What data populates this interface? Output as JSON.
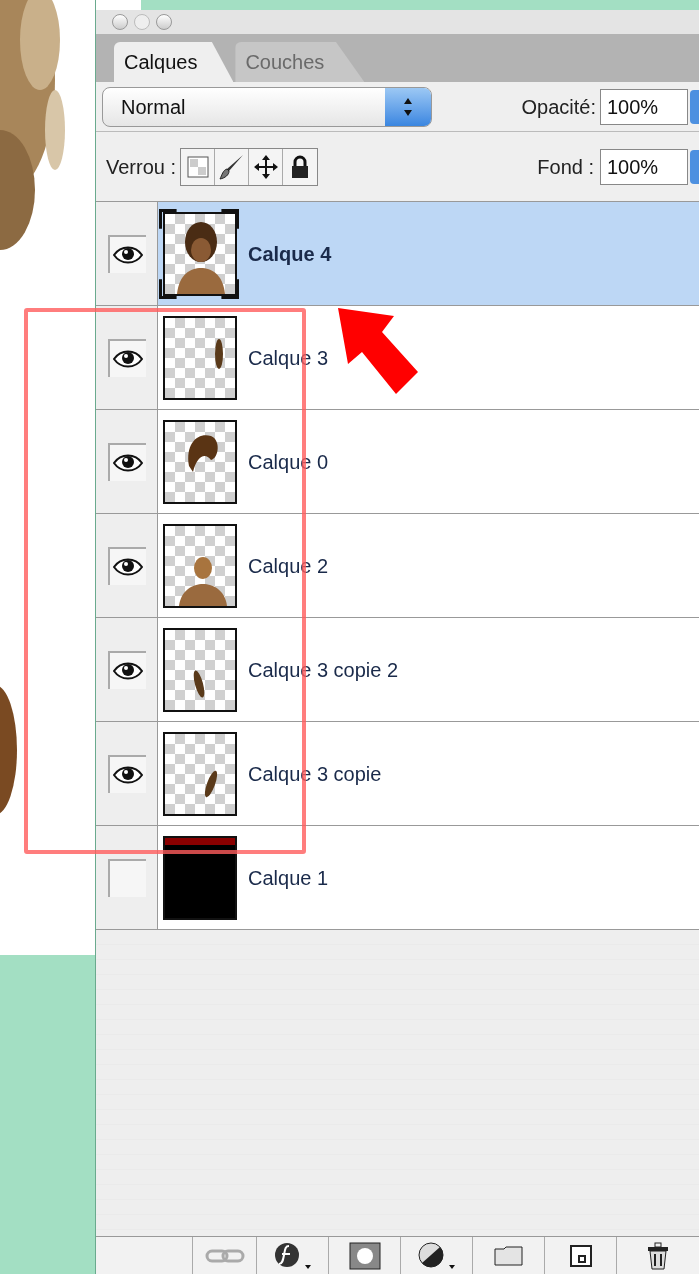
{
  "tabs": [
    {
      "label": "Calques",
      "selected": true
    },
    {
      "label": "Couches",
      "selected": false
    }
  ],
  "blend_mode": "Normal",
  "opacity": {
    "label": "Opacité:",
    "value": "100%"
  },
  "lock": {
    "label": "Verrou :"
  },
  "fill": {
    "label": "Fond :",
    "value": "100%"
  },
  "layers": [
    {
      "name": "Calque 4",
      "visible": true,
      "selected": true,
      "kind": "figure"
    },
    {
      "name": "Calque 3",
      "visible": true,
      "selected": false,
      "kind": "strand"
    },
    {
      "name": "Calque 0",
      "visible": true,
      "selected": false,
      "kind": "hair"
    },
    {
      "name": "Calque 2",
      "visible": true,
      "selected": false,
      "kind": "bust"
    },
    {
      "name": "Calque 3 copie 2",
      "visible": true,
      "selected": false,
      "kind": "strand-low"
    },
    {
      "name": "Calque 3 copie",
      "visible": true,
      "selected": false,
      "kind": "strand-right"
    },
    {
      "name": "Calque 1",
      "visible": false,
      "selected": false,
      "kind": "black"
    }
  ]
}
